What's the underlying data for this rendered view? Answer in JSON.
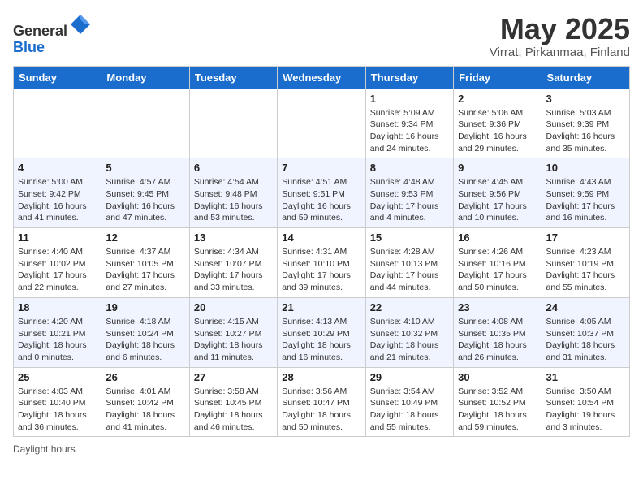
{
  "header": {
    "logo": {
      "line1": "General",
      "line2": "Blue"
    },
    "title": "May 2025",
    "location": "Virrat, Pirkanmaa, Finland"
  },
  "days_of_week": [
    "Sunday",
    "Monday",
    "Tuesday",
    "Wednesday",
    "Thursday",
    "Friday",
    "Saturday"
  ],
  "weeks": [
    {
      "days": [
        {
          "number": "",
          "info": ""
        },
        {
          "number": "",
          "info": ""
        },
        {
          "number": "",
          "info": ""
        },
        {
          "number": "",
          "info": ""
        },
        {
          "number": "1",
          "info": "Sunrise: 5:09 AM\nSunset: 9:34 PM\nDaylight: 16 hours and 24 minutes."
        },
        {
          "number": "2",
          "info": "Sunrise: 5:06 AM\nSunset: 9:36 PM\nDaylight: 16 hours and 29 minutes."
        },
        {
          "number": "3",
          "info": "Sunrise: 5:03 AM\nSunset: 9:39 PM\nDaylight: 16 hours and 35 minutes."
        }
      ]
    },
    {
      "days": [
        {
          "number": "4",
          "info": "Sunrise: 5:00 AM\nSunset: 9:42 PM\nDaylight: 16 hours and 41 minutes."
        },
        {
          "number": "5",
          "info": "Sunrise: 4:57 AM\nSunset: 9:45 PM\nDaylight: 16 hours and 47 minutes."
        },
        {
          "number": "6",
          "info": "Sunrise: 4:54 AM\nSunset: 9:48 PM\nDaylight: 16 hours and 53 minutes."
        },
        {
          "number": "7",
          "info": "Sunrise: 4:51 AM\nSunset: 9:51 PM\nDaylight: 16 hours and 59 minutes."
        },
        {
          "number": "8",
          "info": "Sunrise: 4:48 AM\nSunset: 9:53 PM\nDaylight: 17 hours and 4 minutes."
        },
        {
          "number": "9",
          "info": "Sunrise: 4:45 AM\nSunset: 9:56 PM\nDaylight: 17 hours and 10 minutes."
        },
        {
          "number": "10",
          "info": "Sunrise: 4:43 AM\nSunset: 9:59 PM\nDaylight: 17 hours and 16 minutes."
        }
      ]
    },
    {
      "days": [
        {
          "number": "11",
          "info": "Sunrise: 4:40 AM\nSunset: 10:02 PM\nDaylight: 17 hours and 22 minutes."
        },
        {
          "number": "12",
          "info": "Sunrise: 4:37 AM\nSunset: 10:05 PM\nDaylight: 17 hours and 27 minutes."
        },
        {
          "number": "13",
          "info": "Sunrise: 4:34 AM\nSunset: 10:07 PM\nDaylight: 17 hours and 33 minutes."
        },
        {
          "number": "14",
          "info": "Sunrise: 4:31 AM\nSunset: 10:10 PM\nDaylight: 17 hours and 39 minutes."
        },
        {
          "number": "15",
          "info": "Sunrise: 4:28 AM\nSunset: 10:13 PM\nDaylight: 17 hours and 44 minutes."
        },
        {
          "number": "16",
          "info": "Sunrise: 4:26 AM\nSunset: 10:16 PM\nDaylight: 17 hours and 50 minutes."
        },
        {
          "number": "17",
          "info": "Sunrise: 4:23 AM\nSunset: 10:19 PM\nDaylight: 17 hours and 55 minutes."
        }
      ]
    },
    {
      "days": [
        {
          "number": "18",
          "info": "Sunrise: 4:20 AM\nSunset: 10:21 PM\nDaylight: 18 hours and 0 minutes."
        },
        {
          "number": "19",
          "info": "Sunrise: 4:18 AM\nSunset: 10:24 PM\nDaylight: 18 hours and 6 minutes."
        },
        {
          "number": "20",
          "info": "Sunrise: 4:15 AM\nSunset: 10:27 PM\nDaylight: 18 hours and 11 minutes."
        },
        {
          "number": "21",
          "info": "Sunrise: 4:13 AM\nSunset: 10:29 PM\nDaylight: 18 hours and 16 minutes."
        },
        {
          "number": "22",
          "info": "Sunrise: 4:10 AM\nSunset: 10:32 PM\nDaylight: 18 hours and 21 minutes."
        },
        {
          "number": "23",
          "info": "Sunrise: 4:08 AM\nSunset: 10:35 PM\nDaylight: 18 hours and 26 minutes."
        },
        {
          "number": "24",
          "info": "Sunrise: 4:05 AM\nSunset: 10:37 PM\nDaylight: 18 hours and 31 minutes."
        }
      ]
    },
    {
      "days": [
        {
          "number": "25",
          "info": "Sunrise: 4:03 AM\nSunset: 10:40 PM\nDaylight: 18 hours and 36 minutes."
        },
        {
          "number": "26",
          "info": "Sunrise: 4:01 AM\nSunset: 10:42 PM\nDaylight: 18 hours and 41 minutes."
        },
        {
          "number": "27",
          "info": "Sunrise: 3:58 AM\nSunset: 10:45 PM\nDaylight: 18 hours and 46 minutes."
        },
        {
          "number": "28",
          "info": "Sunrise: 3:56 AM\nSunset: 10:47 PM\nDaylight: 18 hours and 50 minutes."
        },
        {
          "number": "29",
          "info": "Sunrise: 3:54 AM\nSunset: 10:49 PM\nDaylight: 18 hours and 55 minutes."
        },
        {
          "number": "30",
          "info": "Sunrise: 3:52 AM\nSunset: 10:52 PM\nDaylight: 18 hours and 59 minutes."
        },
        {
          "number": "31",
          "info": "Sunrise: 3:50 AM\nSunset: 10:54 PM\nDaylight: 19 hours and 3 minutes."
        }
      ]
    }
  ],
  "footer": {
    "note": "Daylight hours"
  }
}
